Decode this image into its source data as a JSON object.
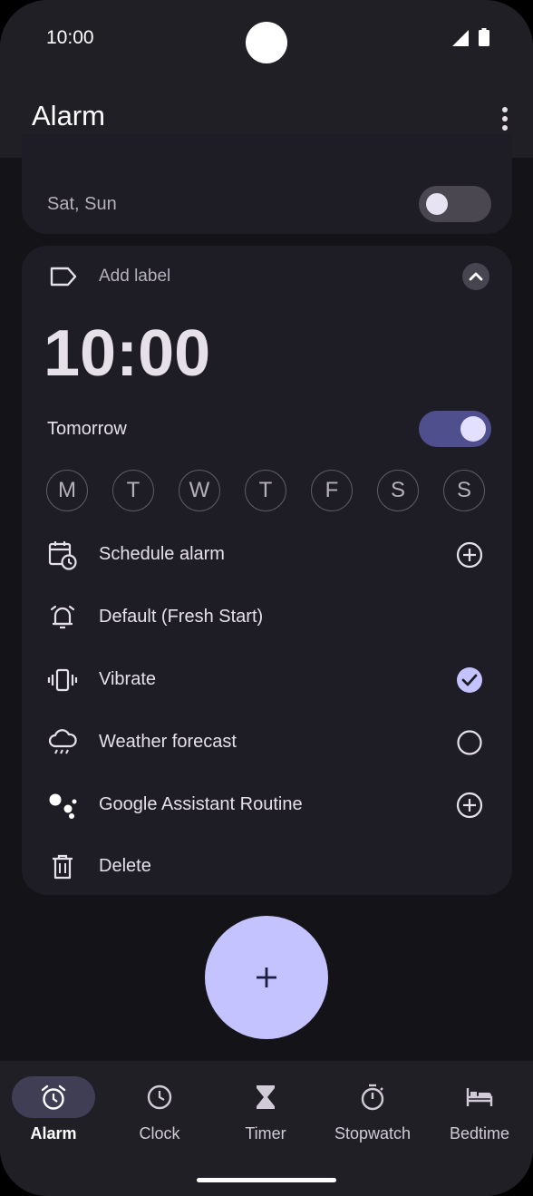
{
  "status": {
    "time": "10:00"
  },
  "app": {
    "title": "Alarm"
  },
  "alarm_prev": {
    "days": "Sat, Sun",
    "enabled": false
  },
  "alarm": {
    "label_placeholder": "Add label",
    "time": "10:00",
    "when": "Tomorrow",
    "enabled": true,
    "days": [
      "M",
      "T",
      "W",
      "T",
      "F",
      "S",
      "S"
    ],
    "options": {
      "schedule": "Schedule alarm",
      "sound": "Default (Fresh Start)",
      "vibrate": "Vibrate",
      "weather": "Weather forecast",
      "assistant": "Google Assistant Routine",
      "delete": "Delete"
    }
  },
  "fab": {
    "icon": "plus-icon"
  },
  "nav": {
    "items": [
      {
        "label": "Alarm",
        "icon": "alarm-icon",
        "active": true
      },
      {
        "label": "Clock",
        "icon": "clock-icon",
        "active": false
      },
      {
        "label": "Timer",
        "icon": "hourglass-icon",
        "active": false
      },
      {
        "label": "Stopwatch",
        "icon": "stopwatch-icon",
        "active": false
      },
      {
        "label": "Bedtime",
        "icon": "bed-icon",
        "active": false
      }
    ]
  },
  "colors": {
    "accent": "#c4c3ff",
    "switch_on": "#4f4f8e",
    "surface": "#1e1d25",
    "background": "#141318"
  }
}
